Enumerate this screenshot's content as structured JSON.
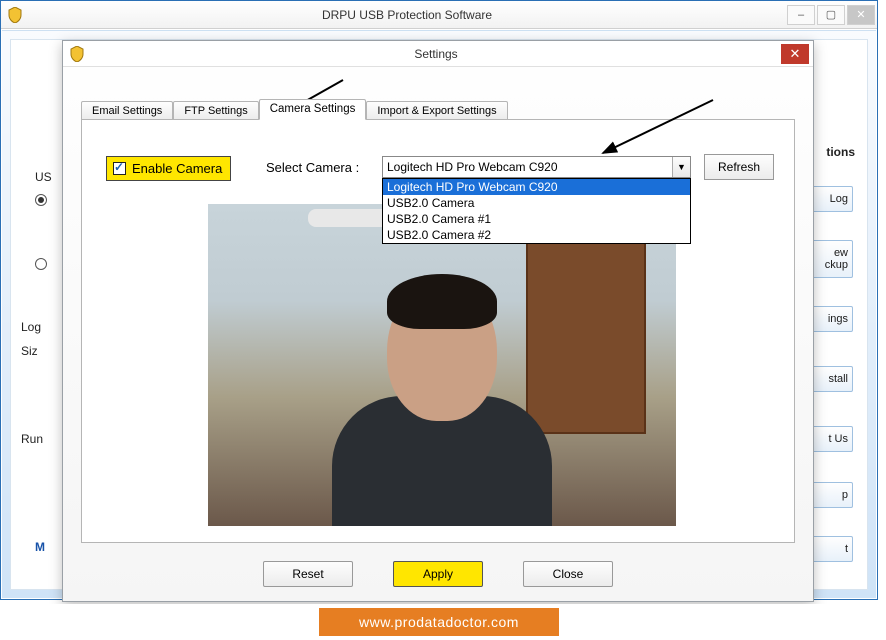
{
  "app": {
    "title": "DRPU USB Protection Software",
    "minimize": "–",
    "maximize": "▢",
    "close": "✕"
  },
  "dialog": {
    "title": "Settings",
    "close": "✕",
    "tabs": [
      {
        "label": "Email Settings"
      },
      {
        "label": "FTP Settings"
      },
      {
        "label": "Camera Settings"
      },
      {
        "label": "Import & Export Settings"
      }
    ],
    "active_tab_label": "Camera Settings",
    "enable_camera": "Enable Camera",
    "select_camera_label": "Select Camera :",
    "selected_camera": "Logitech HD Pro Webcam C920",
    "camera_options": [
      "Logitech HD Pro Webcam C920",
      "USB2.0 Camera",
      "USB2.0 Camera #1",
      "USB2.0 Camera #2"
    ],
    "refresh": "Refresh",
    "buttons": {
      "reset": "Reset",
      "apply": "Apply",
      "close": "Close"
    }
  },
  "behind": {
    "tions": "tions",
    "log": "Log",
    "view_backup_1": "ew",
    "view_backup_2": "ckup",
    "ings": "ings",
    "stall": "stall",
    "us": "t Us",
    "p": "p",
    "t": "t",
    "us_label": "US",
    "log_label": "Log",
    "siz_label": "Siz",
    "run_label": "Run",
    "m_label": "M"
  },
  "footer": {
    "url": "www.prodatadoctor.com"
  }
}
